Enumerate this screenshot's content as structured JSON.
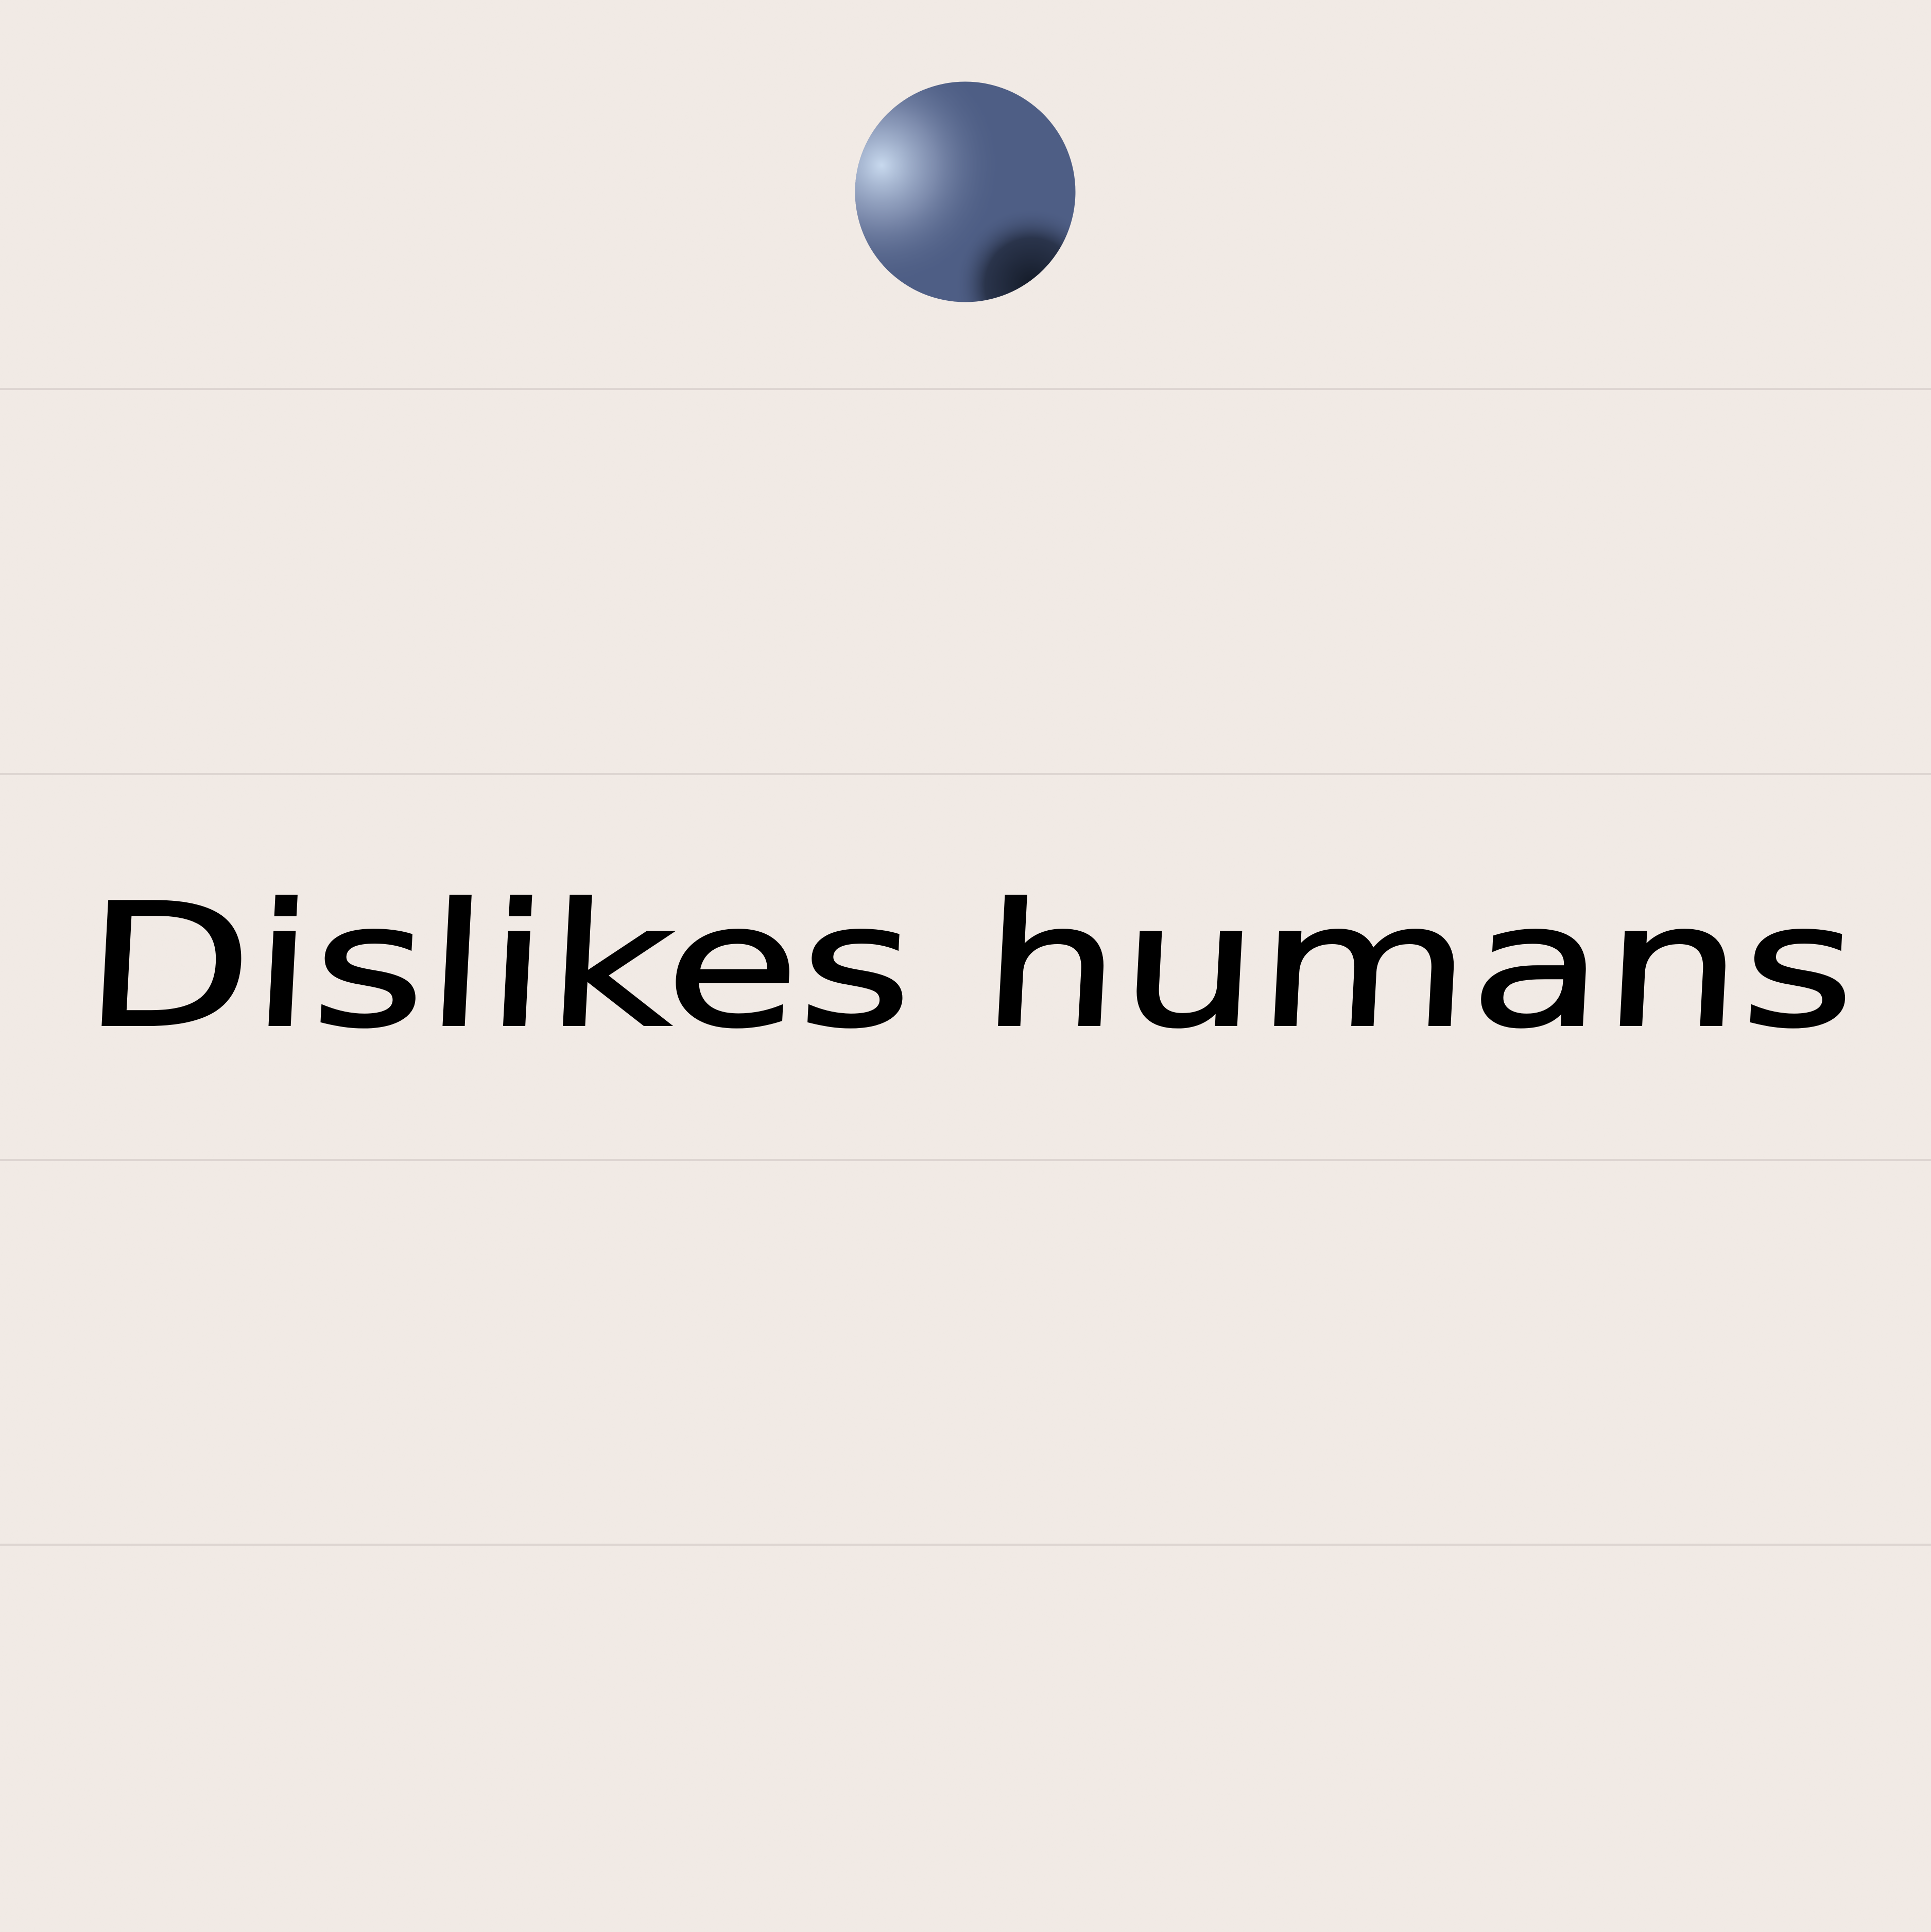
{
  "note": {
    "text": "Dislikes humans"
  },
  "colors": {
    "paper": "#f2ebe6",
    "rule": "#ddd5d1",
    "ink": "#000000",
    "pin_base": "#4e5e85",
    "pin_highlight": "#c8d9ee",
    "pin_shadow": "#141b28"
  },
  "icons": {
    "pin": "pushpin-icon"
  }
}
